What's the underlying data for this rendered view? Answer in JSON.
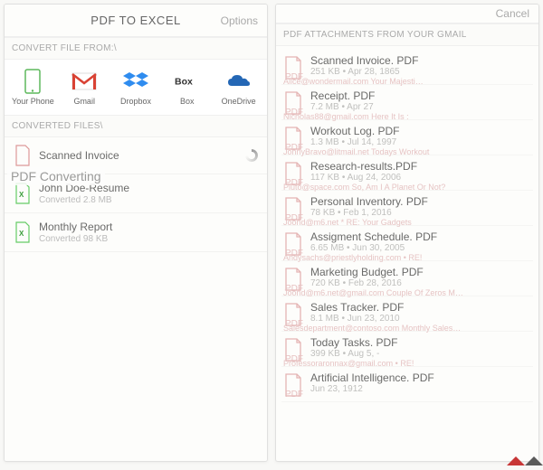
{
  "left": {
    "title": "PDF TO EXCEL",
    "options": "Options",
    "convert_from": "CONVERT FILE FROM:\\",
    "sources": [
      {
        "label": "Your Phone"
      },
      {
        "label": "Gmail"
      },
      {
        "label": "Dropbox"
      },
      {
        "label": "Box"
      },
      {
        "label": "OneDrive"
      }
    ],
    "converted_label": "CONVERTED FILES\\",
    "converting_text": "PDF Converting",
    "files": [
      {
        "name": "Scanned Invoice",
        "meta": ""
      },
      {
        "name": "John Doe-Resume",
        "meta": "Converted 2.8 MB"
      },
      {
        "name": "Monthly Report",
        "meta": "Converted 98 KB"
      }
    ]
  },
  "right": {
    "cancel": "Cancel",
    "section": "PDF ATTACHMENTS FROM YOUR GMAIL",
    "items": [
      {
        "name": "Scanned Invoice. PDF",
        "meta": "251 KB • Apr 28, 1865",
        "from": "Alice@wondermail.com Your Majesti…"
      },
      {
        "name": "Receipt. PDF",
        "meta": "7.2 MB • Apr 27",
        "from": "Nicholas88@gmail.com Here It Is :"
      },
      {
        "name": "Workout Log. PDF",
        "meta": "1.3 MB • Jul 14, 1997",
        "from": "JohnyBravo@litmail.net Todays Workout"
      },
      {
        "name": "Research-results.PDF",
        "meta": "117 KB • Aug 24, 2006",
        "from": "Pluto@space.com So, Am I A Planet Or Not?"
      },
      {
        "name": "Personal Inventory. PDF",
        "meta": "78 KB • Feb 1, 2016",
        "from": "Joond@m6.net * RE: Your Gadgets"
      },
      {
        "name": "Assigment Schedule. PDF",
        "meta": "6.65 MB • Jun 30, 2005",
        "from": "Andysachs@priestlyholding.com • RE!"
      },
      {
        "name": "Marketing Budget. PDF",
        "meta": "720 KB • Feb 28, 2016",
        "from": "Joond@m6.net@gmail.com Couple Of Zeros M…"
      },
      {
        "name": "Sales Tracker. PDF",
        "meta": "8.1 MB • Jun 23, 2010",
        "from": "Salesdepartment@contoso.com Monthly Sales…"
      },
      {
        "name": "Today Tasks. PDF",
        "meta": "399 KB • Aug 5, -",
        "from": "Professoraronnax@gmail.com • RE!"
      },
      {
        "name": "Artificial Intelligence. PDF",
        "meta": "Jun 23, 1912",
        "from": ""
      }
    ]
  }
}
